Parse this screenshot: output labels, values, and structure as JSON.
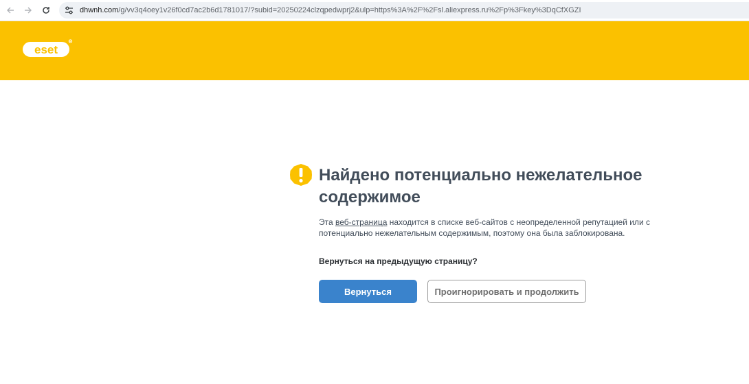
{
  "browser": {
    "url_host": "dhwnh.com",
    "url_rest": "/g/vv3q4oey1v26f0cd7ac2b6d1781017/?subid=20250224clzqpedwprj2&ulp=https%3A%2F%2Fsl.aliexpress.ru%2Fp%3Fkey%3DqCfXGZI",
    "back_icon": "arrow-left-icon",
    "forward_icon": "arrow-right-icon",
    "reload_icon": "reload-icon",
    "site_info_icon": "tune-icon"
  },
  "header": {
    "brand_color": "#fbc100",
    "logo_text": "eset"
  },
  "main": {
    "warning_icon": "warning-exclamation-icon",
    "title": "Найдено потенциально нежелательное содержимое",
    "description_before": "Эта ",
    "description_link": "веб-страница",
    "description_after": " находится в списке веб-сайтов с неопределенной репутацией или с потенциально нежелательным содержимым, поэтому она была заблокирована.",
    "question": "Вернуться на предыдущую страницу?",
    "back_button": "Вернуться",
    "ignore_button": "Проигнорировать и продолжить",
    "accent_color": "#3a83cc"
  }
}
